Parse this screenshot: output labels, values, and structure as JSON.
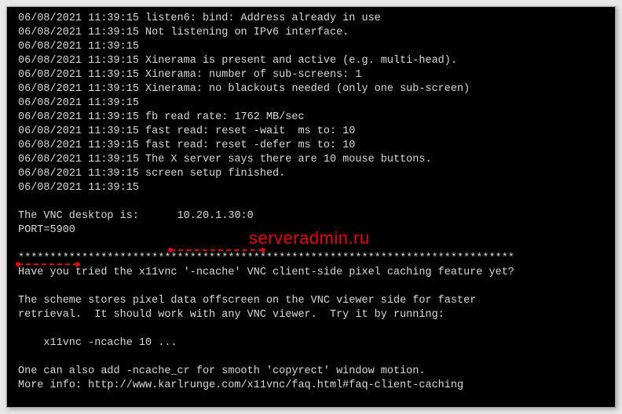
{
  "watermark": "serveradmin.ru",
  "lines": {
    "l0": "06/08/2021 11:39:15 listen6: bind: Address already in use",
    "l1": "06/08/2021 11:39:15 Not listening on IPv6 interface.",
    "l2": "06/08/2021 11:39:15",
    "l3": "06/08/2021 11:39:15 Xinerama is present and active (e.g. multi-head).",
    "l4": "06/08/2021 11:39:15 Xinerama: number of sub-screens: 1",
    "l5": "06/08/2021 11:39:15 Xinerama: no blackouts needed (only one sub-screen)",
    "l6": "06/08/2021 11:39:15",
    "l7": "06/08/2021 11:39:15 fb read rate: 1762 MB/sec",
    "l8": "06/08/2021 11:39:15 fast read: reset -wait  ms to: 10",
    "l9": "06/08/2021 11:39:15 fast read: reset -defer ms to: 10",
    "l10": "06/08/2021 11:39:15 The X server says there are 10 mouse buttons.",
    "l11": "06/08/2021 11:39:15 screen setup finished.",
    "l12": "06/08/2021 11:39:15",
    "l13": "",
    "l14": "The VNC desktop is:      10.20.1.30:0",
    "l15": "PORT=5900",
    "l16": "",
    "l17": "******************************************************************************",
    "l18": "Have you tried the x11vnc '-ncache' VNC client-side pixel caching feature yet?",
    "l19": "",
    "l20": "The scheme stores pixel data offscreen on the VNC viewer side for faster",
    "l21": "retrieval.  It should work with any VNC viewer.  Try it by running:",
    "l22": "",
    "l23": "    x11vnc -ncache 10 ...",
    "l24": "",
    "l25": "One can also add -ncache_cr for smooth 'copyrect' window motion.",
    "l26": "More info: http://www.karlrunge.com/x11vnc/faq.html#faq-client-caching"
  }
}
